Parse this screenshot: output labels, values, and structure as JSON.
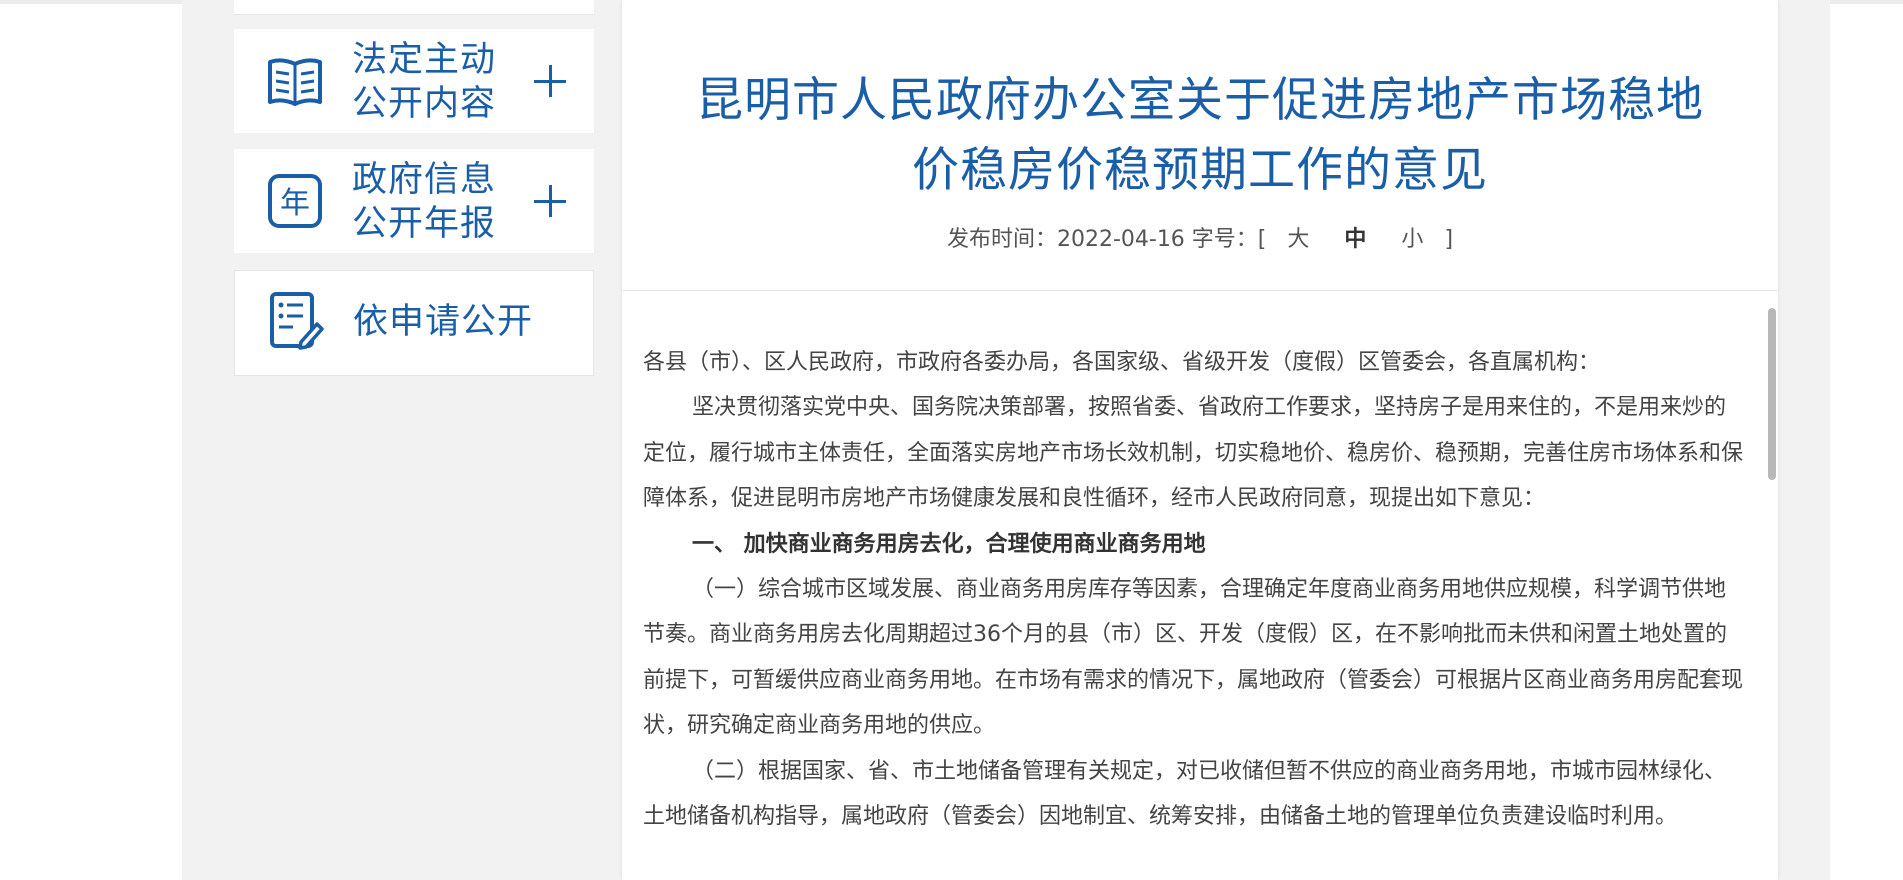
{
  "colors": {
    "accent": "#1a5ea8",
    "text": "#444444",
    "band": "#f2f2f2"
  },
  "sidebar": {
    "items": [
      {
        "icon": "document-list-icon",
        "line1": "法定主动",
        "line2": "公开内容",
        "expandable": true
      },
      {
        "icon": "year-calendar-icon",
        "line1": "政府信息",
        "line2": "公开年报",
        "expandable": true
      },
      {
        "icon": "application-form-icon",
        "line1": "依申请公开",
        "line2": "",
        "expandable": false
      }
    ]
  },
  "article": {
    "title_line1": "昆明市人民政府办公室关于促进房地产市场稳地",
    "title_line2": "价稳房价稳预期工作的意见",
    "meta_prefix": "发布时间：2022-04-16 字号：[",
    "size_large": "大",
    "size_medium": "中",
    "size_small": "小",
    "meta_suffix": "]",
    "salutation": "各县（市）、区人民政府，市政府各委办局，各国家级、省级开发（度假）区管委会，各直属机构：",
    "para1": "坚决贯彻落实党中央、国务院决策部署，按照省委、省政府工作要求，坚持房子是用来住的，不是用来炒的定位，履行城市主体责任，全面落实房地产市场长效机制，切实稳地价、稳房价、稳预期，完善住房市场体系和保障体系，促进昆明市房地产市场健康发展和良性循环，经市人民政府同意，现提出如下意见：",
    "heading1": "一、 加快商业商务用房去化，合理使用商业商务用地",
    "para2": "（一）综合城市区域发展、商业商务用房库存等因素，合理确定年度商业商务用地供应规模，科学调节供地节奏。商业商务用房去化周期超过36个月的县（市）区、开发（度假）区，在不影响批而未供和闲置土地处置的前提下，可暂缓供应商业商务用地。在市场有需求的情况下，属地政府（管委会）可根据片区商业商务用房配套现状，研究确定商业商务用地的供应。",
    "para3": "（二）根据国家、省、市土地储备管理有关规定，对已收储但暂不供应的商业商务用地，市城市园林绿化、土地储备机构指导，属地政府（管委会）因地制宜、统筹安排，由储备土地的管理单位负责建设临时利用。"
  }
}
